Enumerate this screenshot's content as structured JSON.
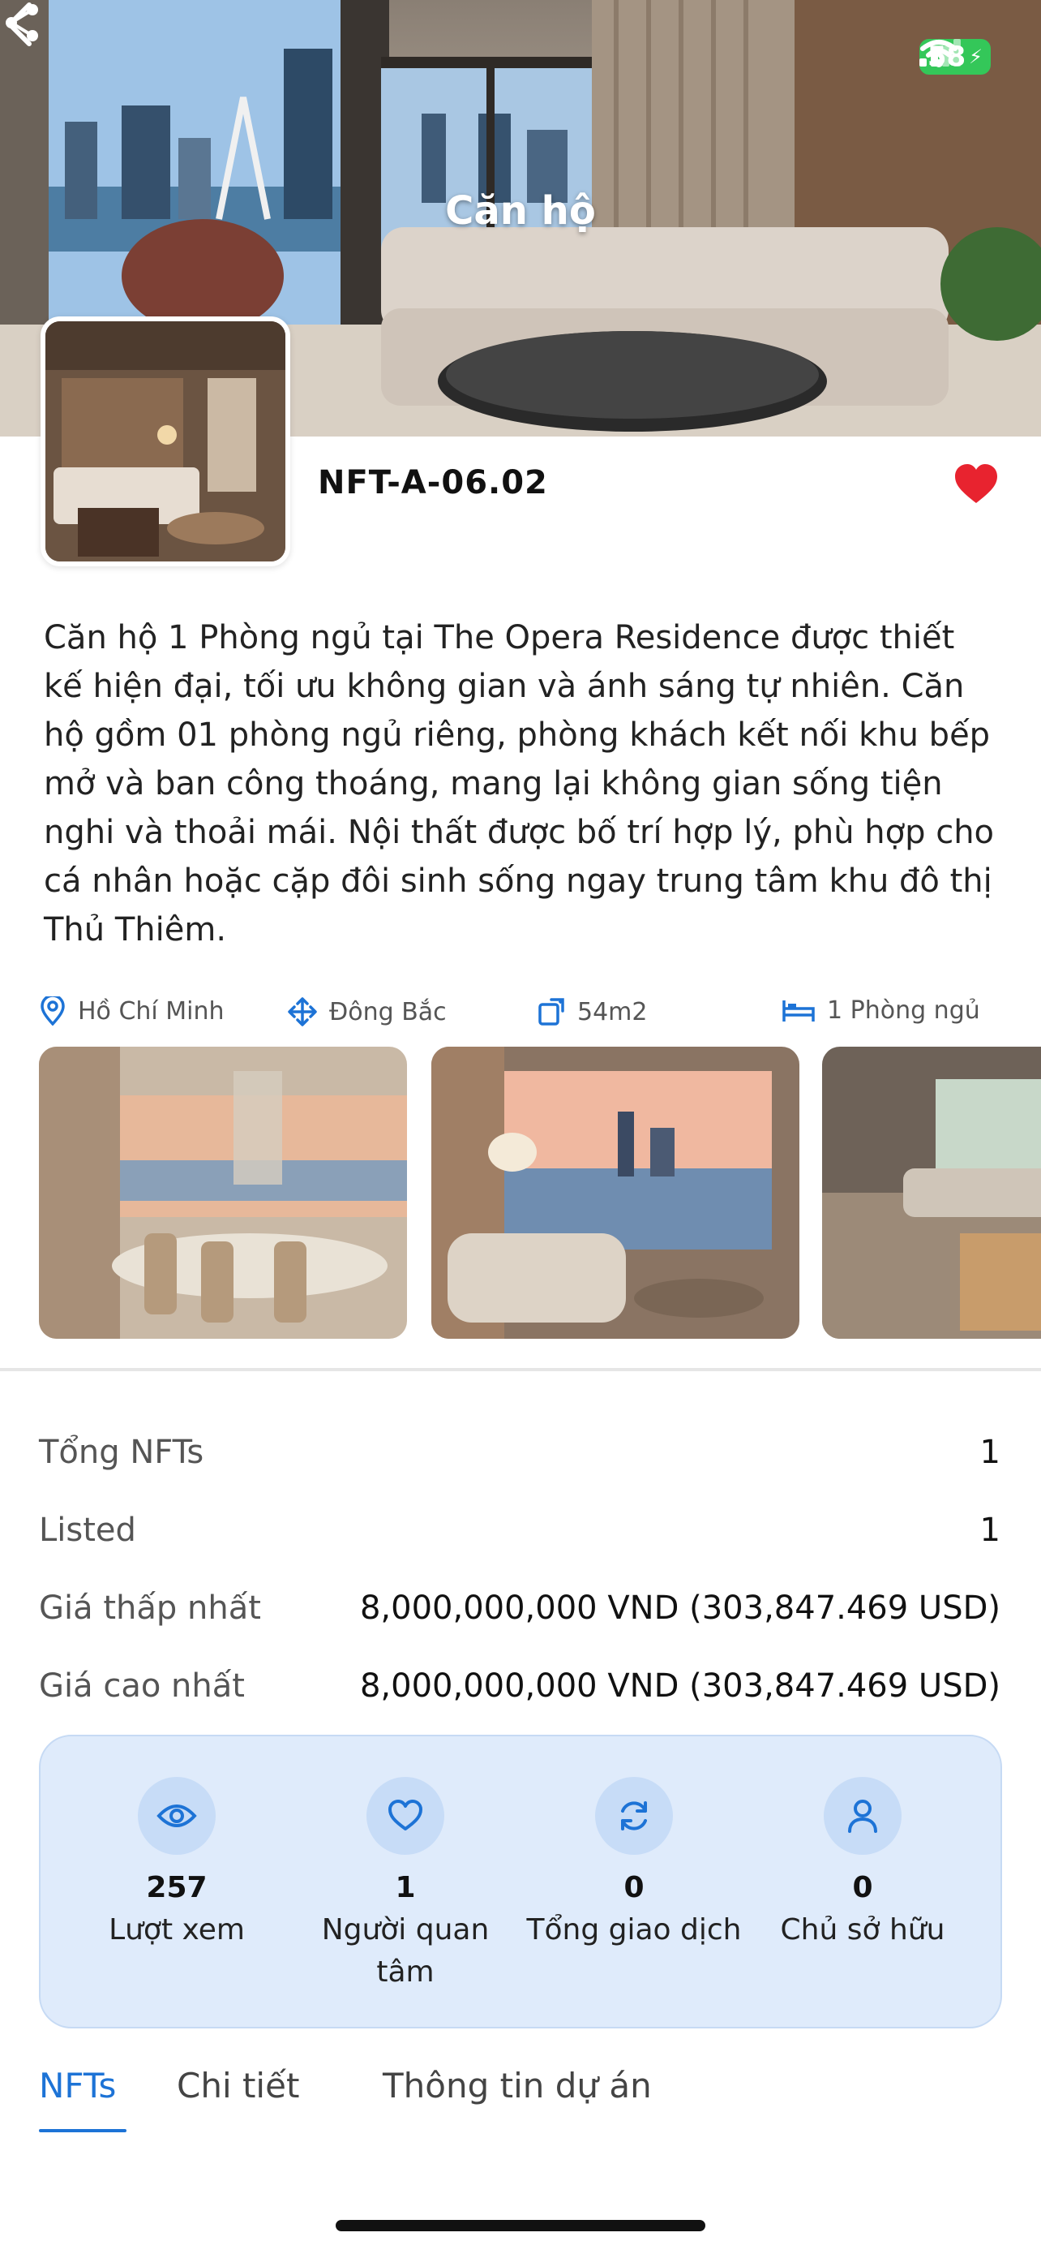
{
  "status_bar": {
    "battery": "58"
  },
  "header": {
    "title": "Căn hộ"
  },
  "nft": {
    "code": "NFT-A-06.02"
  },
  "description": "Căn hộ 1 Phòng ngủ tại The Opera Residence được thiết kế hiện đại, tối ưu không gian và ánh sáng tự nhiên. Căn hộ gồm 01 phòng ngủ riêng, phòng khách kết nối khu bếp mở và ban công thoáng, mang lại không gian sống tiện nghi và thoải mái. Nội thất được bố trí hợp lý, phù hợp cho cá nhân hoặc cặp đôi sinh sống ngay trung tâm khu đô thị Thủ Thiêm.",
  "features": [
    {
      "icon": "location-pin-icon",
      "label": "Hồ Chí Minh"
    },
    {
      "icon": "direction-arrows-icon",
      "label": "Đông Bắc"
    },
    {
      "icon": "area-icon",
      "label": "54m2"
    },
    {
      "icon": "bed-icon",
      "label": "1 Phòng ngủ"
    }
  ],
  "stats": [
    {
      "label": "Tổng NFTs",
      "value": "1"
    },
    {
      "label": "Listed",
      "value": "1"
    },
    {
      "label": "Giá thấp nhất",
      "value": "8,000,000,000 VND (303,847.469 USD)"
    },
    {
      "label": "Giá cao nhất",
      "value": "8,000,000,000 VND (303,847.469 USD)"
    }
  ],
  "metrics": [
    {
      "icon": "eye-icon",
      "value": "257",
      "label": "Lượt xem"
    },
    {
      "icon": "heart-outline-icon",
      "value": "1",
      "label": "Người quan tâm"
    },
    {
      "icon": "refresh-icon",
      "value": "0",
      "label": "Tổng giao dịch"
    },
    {
      "icon": "user-icon",
      "value": "0",
      "label": "Chủ sở hữu"
    }
  ],
  "tabs": [
    {
      "label": "NFTs",
      "active": true
    },
    {
      "label": "Chi tiết",
      "active": false
    },
    {
      "label": "Thông tin dự án",
      "active": false
    }
  ],
  "colors": {
    "accent": "#1d73d6",
    "heart": "#e8232f",
    "card_bg": "#dfebfb",
    "battery": "#34c759"
  }
}
